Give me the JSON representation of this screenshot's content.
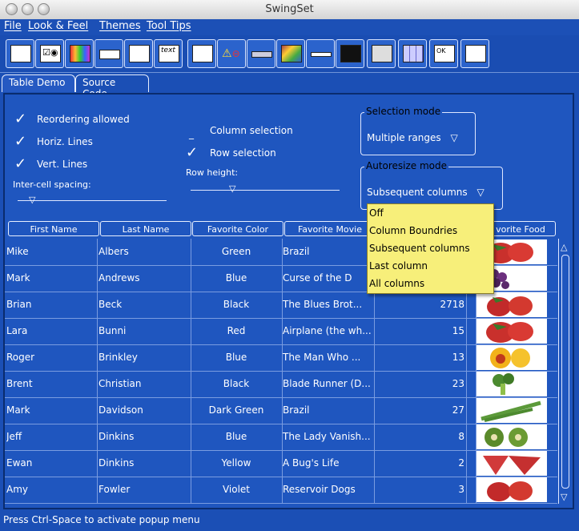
{
  "window": {
    "title": "SwingSet"
  },
  "menu": [
    "File",
    "Look & Feel",
    "Themes",
    "Tool Tips"
  ],
  "toolbar": {
    "buttons": [
      "button-demo-icon",
      "checkbox-demo-icon",
      "color-chooser-icon",
      "combobox-icon",
      "list-demo-icon",
      "text-demo-icon",
      "list-icon",
      "option-pane-icon",
      "progress-bar-icon",
      "scroll-pane-icon",
      "slider-icon",
      "split-pane-icon",
      "tabbed-pane-icon",
      "table-icon",
      "tooltip-icon",
      "tree-icon"
    ]
  },
  "tabs": [
    "Table Demo",
    "Source Code"
  ],
  "controls": {
    "reordering": "Reordering allowed",
    "horiz_lines": "Horiz. Lines",
    "vert_lines": "Vert. Lines",
    "spacing": "Inter-cell spacing:",
    "column_selection": "Column selection",
    "row_selection": "Row selection",
    "row_height": "Row height:",
    "selection_mode_label": "Selection mode",
    "selection_mode_value": "Multiple ranges",
    "autoresize_label": "Autoresize mode",
    "autoresize_value": "Subsequent columns"
  },
  "autoresize_options": [
    "Off",
    "Column Boundries",
    "Subsequent columns",
    "Last column",
    "All columns"
  ],
  "columns": [
    "First Name",
    "Last Name",
    "Favorite Color",
    "Favorite Movie",
    "",
    "",
    "vorite Food"
  ],
  "rows": [
    {
      "first": "Mike",
      "last": "Albers",
      "color": "Green",
      "movie": "Brazil",
      "num": "",
      "food": "strawberry"
    },
    {
      "first": "Mark",
      "last": "Andrews",
      "color": "Blue",
      "movie": "Curse of the D",
      "num": "",
      "food": "grapes"
    },
    {
      "first": "Brian",
      "last": "Beck",
      "color": "Black",
      "movie": "The Blues Brot...",
      "num": "2718",
      "food": "raspberry"
    },
    {
      "first": "Lara",
      "last": "Bunni",
      "color": "Red",
      "movie": "Airplane (the wh...",
      "num": "15",
      "food": "strawberry"
    },
    {
      "first": "Roger",
      "last": "Brinkley",
      "color": "Blue",
      "movie": "The Man Who ...",
      "num": "13",
      "food": "peach"
    },
    {
      "first": "Brent",
      "last": "Christian",
      "color": "Black",
      "movie": "Blade Runner (D...",
      "num": "23",
      "food": "broccoli"
    },
    {
      "first": "Mark",
      "last": "Davidson",
      "color": "Dark Green",
      "movie": "Brazil",
      "num": "27",
      "food": "asparagus"
    },
    {
      "first": "Jeff",
      "last": "Dinkins",
      "color": "Blue",
      "movie": "The Lady Vanish...",
      "num": "8",
      "food": "kiwi"
    },
    {
      "first": "Ewan",
      "last": "Dinkins",
      "color": "Yellow",
      "movie": "A Bug's Life",
      "num": "2",
      "food": "watermelon"
    },
    {
      "first": "Amy",
      "last": "Fowler",
      "color": "Violet",
      "movie": "Reservoir Dogs",
      "num": "3",
      "food": "raspberry"
    }
  ],
  "status": "Press Ctrl-Space to activate popup menu"
}
